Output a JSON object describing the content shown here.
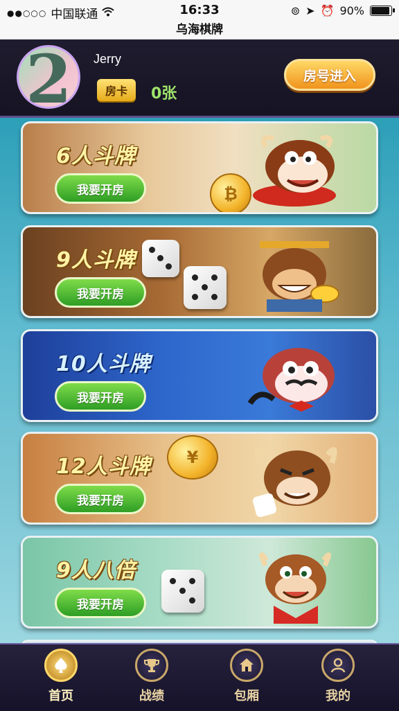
{
  "status_bar": {
    "carrier": "中国联通",
    "signal": "●●○○○",
    "wifi_icon": "wifi-icon",
    "time": "16:33",
    "battery": "90%",
    "battery_level": 0.9
  },
  "app_title": "乌海棋牌",
  "profile": {
    "avatar_text": "2",
    "name": "Jerry",
    "card_label": "房卡",
    "card_count": "0张"
  },
  "header": {
    "room_button": "房号进入"
  },
  "games": [
    {
      "title": "6人斗牌",
      "button": "我要开房"
    },
    {
      "title": "9人斗牌",
      "button": "我要开房"
    },
    {
      "title": "10人斗牌",
      "button": "我要开房"
    },
    {
      "title": "12人斗牌",
      "button": "我要开房"
    },
    {
      "title": "9人八倍",
      "button": "我要开房"
    }
  ],
  "nav": [
    {
      "label": "首页",
      "icon": "spade-icon",
      "active": true
    },
    {
      "label": "战绩",
      "icon": "trophy-icon",
      "active": false
    },
    {
      "label": "包厢",
      "icon": "house-icon",
      "active": false
    },
    {
      "label": "我的",
      "icon": "user-icon",
      "active": false
    }
  ],
  "colors": {
    "accent_gold": "#f0941d",
    "button_green": "#2e9e25",
    "nav_bg": "#15122a"
  }
}
